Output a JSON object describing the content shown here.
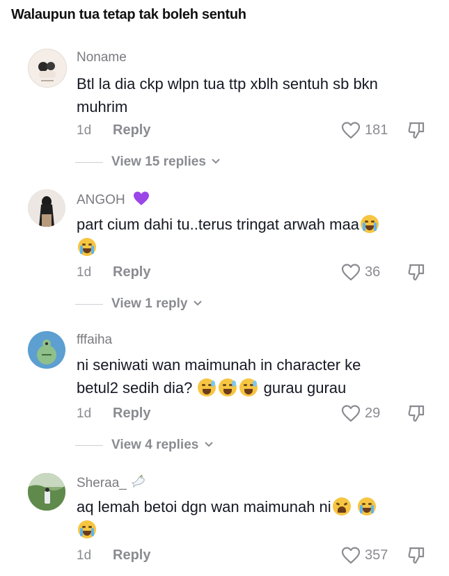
{
  "header": {
    "title": "Walaupun tua tetap tak boleh sentuh"
  },
  "comments": [
    {
      "username": "Noname",
      "text_line1": "Btl la dia ckp wlpn tua ttp xblh sentuh sb bkn",
      "text_line2": "muhrim",
      "time": "1d",
      "reply_label": "Reply",
      "likes": "181",
      "view_replies": "View 15 replies"
    },
    {
      "username": "ANGOH",
      "username_emoji": "purple-heart",
      "text_line1": "part cium dahi tu..terus tringat arwah maa",
      "time": "1d",
      "reply_label": "Reply",
      "likes": "36",
      "view_replies": "View 1 reply"
    },
    {
      "username": "fffaiha",
      "text_line1": "ni seniwati wan maimunah in character ke",
      "text_line2_start": "betul2 sedih dia?",
      "text_line2_end": "gurau gurau",
      "time": "1d",
      "reply_label": "Reply",
      "likes": "29",
      "view_replies": "View 4 replies"
    },
    {
      "username": "Sheraa_",
      "username_emoji": "dove",
      "text_line1": "aq lemah betoi dgn wan maimunah ni",
      "time": "1d",
      "reply_label": "Reply",
      "likes": "357"
    }
  ],
  "icons": {
    "like": "heart-outline-icon",
    "dislike": "thumbs-down-icon",
    "chevron": "chevron-down-icon"
  },
  "colors": {
    "text": "#161823",
    "muted": "#8a8b91",
    "purple_heart": "#9b46e8"
  }
}
